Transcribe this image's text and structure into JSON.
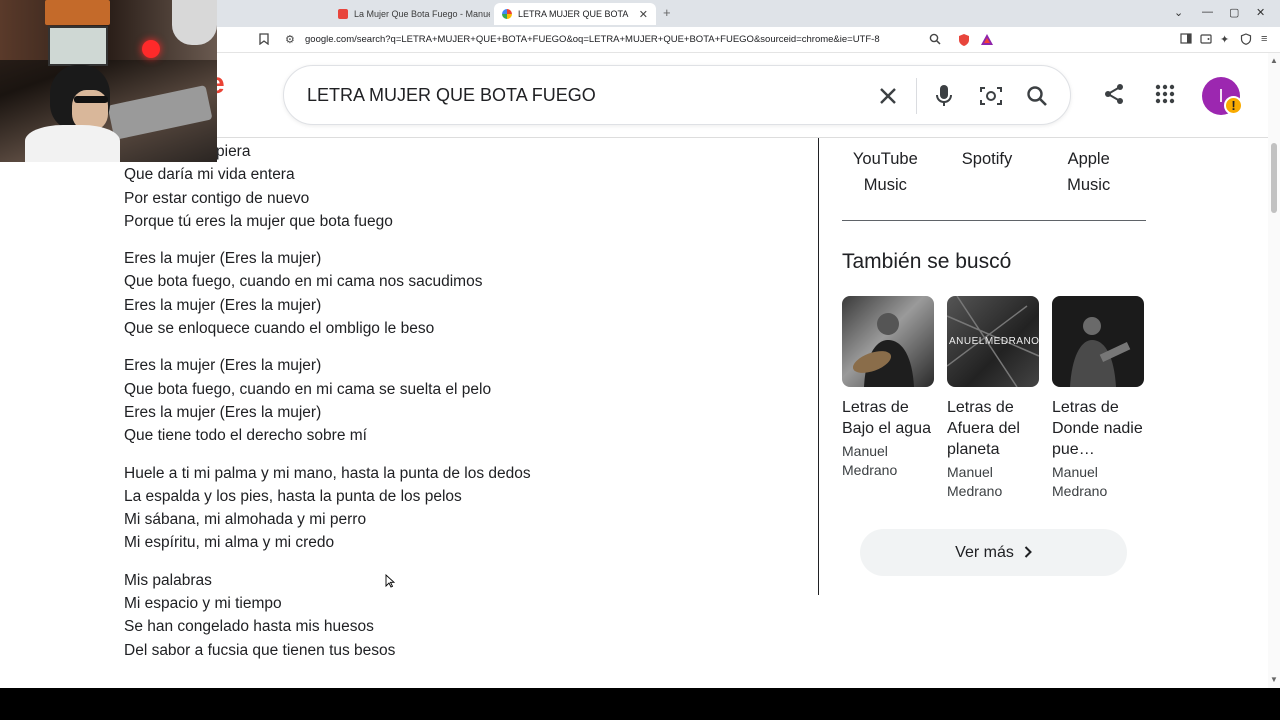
{
  "browser": {
    "tabs": [
      {
        "title": "La Mujer Que Bota Fuego - Manuel M",
        "active": false
      },
      {
        "title": "LETRA MUJER QUE BOTA FUEGO",
        "active": true
      }
    ],
    "url": "google.com/search?q=LETRA+MUJER+QUE+BOTA+FUEGO&oq=LETRA+MUJER+QUE+BOTA+FUEGO&sourceid=chrome&ie=UTF-8"
  },
  "search": {
    "query": "LETRA MUJER QUE BOTA FUEGO"
  },
  "account": {
    "initial": "I",
    "warning": "!"
  },
  "lyrics": {
    "stanzas": [
      [
        "piera",
        "Que daría mi vida entera",
        "Por estar contigo de nuevo",
        "Porque tú eres la mujer que bota fuego"
      ],
      [
        "Eres la mujer (Eres la mujer)",
        "Que bota fuego, cuando en mi cama nos sacudimos",
        "Eres la mujer (Eres la mujer)",
        "Que se enloquece cuando el ombligo le beso"
      ],
      [
        "Eres la mujer (Eres la mujer)",
        "Que bota fuego, cuando en mi cama se suelta el pelo",
        "Eres la mujer (Eres la mujer)",
        "Que tiene todo el derecho sobre mí"
      ],
      [
        "Huele a ti mi palma y mi mano, hasta la punta de los dedos",
        "La espalda y los pies, hasta la punta de los pelos",
        "Mi sábana, mi almohada y mi perro",
        "Mi espíritu, mi alma y mi credo"
      ],
      [
        "Mis palabras",
        "Mi espacio y mi tiempo",
        "Se han congelado hasta mis huesos",
        "Del sabor a fucsia que tienen tus besos"
      ]
    ]
  },
  "providers": [
    {
      "name": "YouTube Music"
    },
    {
      "name": "Spotify"
    },
    {
      "name": "Apple Music"
    }
  ],
  "also_searched": {
    "title": "También se buscó",
    "items": [
      {
        "title": "Letras de Bajo el agua",
        "artist": "Manuel Medrano"
      },
      {
        "title": "Letras de Afuera del planeta",
        "artist": "Manuel Medrano",
        "thumb_text": "ANUELMEDRANO"
      },
      {
        "title": "Letras de Donde nadie pue…",
        "artist": "Manuel Medrano"
      }
    ],
    "more_label": "Ver más"
  },
  "colors": {
    "avatar": "#9c27b0",
    "warning": "#f9ab00",
    "google_red": "#ea4335"
  }
}
